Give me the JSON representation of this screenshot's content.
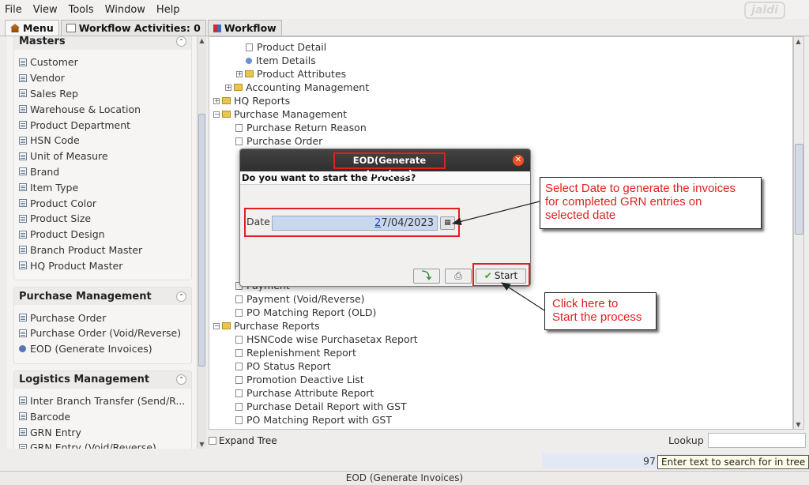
{
  "menu": [
    "File",
    "View",
    "Tools",
    "Window",
    "Help"
  ],
  "logo_text": "jaldi",
  "tabs": [
    {
      "label": "Menu",
      "icon": "home-icon"
    },
    {
      "label": "Workflow Activities: 0",
      "icon": "list-icon"
    },
    {
      "label": "Workflow",
      "icon": "workflow-icon"
    }
  ],
  "sidebar": {
    "masters": {
      "title": "Masters",
      "items": [
        "Customer",
        "Vendor",
        "Sales Rep",
        "Warehouse & Location",
        "Product Department",
        "HSN Code",
        "Unit of Measure",
        "Brand",
        "Item Type",
        "Product Color",
        "Product Size",
        "Product Design",
        "Branch Product Master",
        "HQ Product Master"
      ]
    },
    "purchase": {
      "title": "Purchase Management",
      "items": [
        "Purchase Order",
        "Purchase Order (Void/Reverse)",
        "EOD (Generate Invoices)"
      ]
    },
    "logistics": {
      "title": "Logistics Management",
      "items": [
        "Inter Branch Transfer (Send/R...",
        "Barcode",
        "GRN Entry",
        "GRN Entry (Void/Reverse)"
      ]
    }
  },
  "tree": {
    "rows": [
      {
        "label": "Product Detail",
        "type": "leaf"
      },
      {
        "label": "Item Details",
        "type": "dot"
      },
      {
        "label": "Product Attributes",
        "type": "folder-collapsed"
      },
      {
        "label": "Accounting Management",
        "type": "folder-collapsed"
      },
      {
        "label": "HQ Reports",
        "type": "folder-collapsed"
      },
      {
        "label": "Purchase Management",
        "type": "folder-open"
      },
      {
        "label": "Purchase Return Reason",
        "type": "leaf"
      },
      {
        "label": "Purchase Order",
        "type": "leaf"
      },
      {
        "label": "Payment",
        "type": "leaf"
      },
      {
        "label": "Payment (Void/Reverse)",
        "type": "leaf"
      },
      {
        "label": "PO Matching Report (OLD)",
        "type": "leaf"
      },
      {
        "label": "Purchase Reports",
        "type": "folder-open"
      },
      {
        "label": "HSNCode wise Purchasetax Report",
        "type": "leaf"
      },
      {
        "label": "Replenishment Report",
        "type": "leaf"
      },
      {
        "label": "PO Status Report",
        "type": "leaf"
      },
      {
        "label": "Promotion Deactive List",
        "type": "leaf"
      },
      {
        "label": "Purchase Attribute Report",
        "type": "leaf"
      },
      {
        "label": "Purchase Detail Report with GST",
        "type": "leaf"
      },
      {
        "label": "PO Matching Report with GST",
        "type": "leaf"
      }
    ],
    "expand_tree_label": "Expand Tree",
    "lookup_label": "Lookup"
  },
  "status": {
    "count": "97",
    "tooltip": "Enter text to search for in tree",
    "bottom_text": "EOD (Generate Invoices)"
  },
  "dialog": {
    "title": "EOD(Generate Invoices)",
    "question": "Do you want to start the Process?",
    "date_label": "Date",
    "date_value_first": "2",
    "date_value_rest": "7/04/2023",
    "start_label": "Start"
  },
  "annotations": {
    "date_note": [
      "Select Date to generate the invoices",
      "for completed GRN entries on",
      "selected date"
    ],
    "start_note": [
      "Click here to",
      "Start the process"
    ]
  },
  "colors": {
    "highlight": "#e02020",
    "callout_text": "#e02020",
    "date_field": "#c8d8ef",
    "title_bar": "#3a3a3a"
  }
}
